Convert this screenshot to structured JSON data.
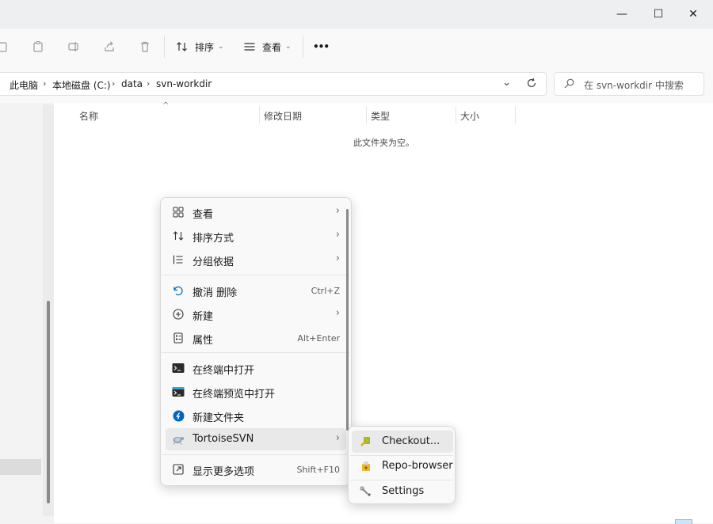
{
  "window": {
    "minimize_glyph": "—",
    "maximize_glyph": "☐",
    "close_glyph": "✕"
  },
  "toolbar": {
    "sort_label": "排序",
    "view_label": "查看",
    "more_label": "•••"
  },
  "address": {
    "crumbs": [
      "此电脑",
      "本地磁盘 (C:)",
      "data",
      "svn-workdir"
    ],
    "search_placeholder": "在 svn-workdir 中搜索"
  },
  "columns": {
    "name": "名称",
    "date": "修改日期",
    "type": "类型",
    "size": "大小"
  },
  "empty_text": "此文件夹为空。",
  "context_menu": {
    "items": [
      {
        "label": "查看",
        "icon": "grid-icon",
        "submenu": true
      },
      {
        "label": "排序方式",
        "icon": "sort-icon",
        "submenu": true
      },
      {
        "label": "分组依据",
        "icon": "group-icon",
        "submenu": true
      },
      {
        "label": "撤消 删除",
        "icon": "undo-icon",
        "shortcut": "Ctrl+Z"
      },
      {
        "label": "新建",
        "icon": "plus-circle-icon",
        "submenu": true
      },
      {
        "label": "属性",
        "icon": "properties-icon",
        "shortcut": "Alt+Enter"
      },
      {
        "label": "在终端中打开",
        "icon": "terminal-icon"
      },
      {
        "label": "在终端预览中打开",
        "icon": "terminal-preview-icon"
      },
      {
        "label": "新建文件夹",
        "icon": "new-folder-icon"
      },
      {
        "label": "TortoiseSVN",
        "icon": "tortoisesvn-icon",
        "submenu": true
      },
      {
        "label": "显示更多选项",
        "icon": "more-options-icon",
        "shortcut": "Shift+F10"
      }
    ]
  },
  "svn_submenu": {
    "items": [
      {
        "label": "Checkout...",
        "icon": "checkout-icon"
      },
      {
        "label": "Repo-browser",
        "icon": "repo-browser-icon"
      },
      {
        "label": "Settings",
        "icon": "settings-wrench-icon"
      }
    ]
  },
  "colors": {
    "accent": "#0067c0",
    "menu_bg": "#f9f9f9",
    "highlight": "#e9e9e9"
  }
}
